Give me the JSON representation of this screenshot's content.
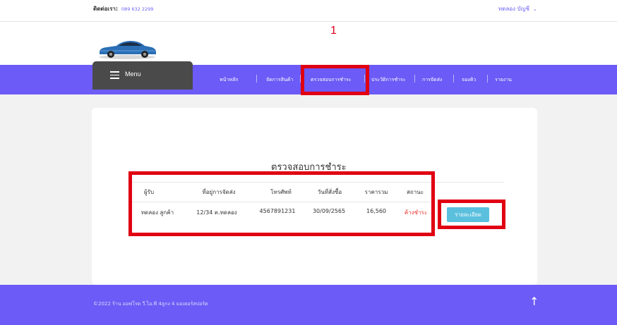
{
  "topbar": {
    "contact_label": "ติดต่อเรา:",
    "contact_phone": "089 632 2299",
    "user_name": "ทดลอง บัญชี",
    "user_chevron": "⌄"
  },
  "logo": {
    "icon": "car-icon"
  },
  "annotation_number": "1",
  "navbar": {
    "menu_label": "Menu",
    "items": [
      {
        "label": "หน้าหลัก"
      },
      {
        "label": "จัดการสินค้า"
      },
      {
        "label": "ตรวจสอบการชำระ"
      },
      {
        "label": "ประวัติการชำระ"
      },
      {
        "label": "การจัดส่ง"
      },
      {
        "label": "จองคิว"
      },
      {
        "label": "รายงาน"
      }
    ]
  },
  "main": {
    "title": "ตรวจสอบการชำระ",
    "table": {
      "headers": [
        "ผู้รับ",
        "ที่อยู่การจัดส่ง",
        "โทรศัพท์",
        "วันที่สั่งซื้อ",
        "ราคารวม",
        "สถานะ"
      ],
      "rows": [
        [
          "ทดลอง ลูกค้า",
          "12/34 ต.ทดลอง",
          "4567891231",
          "30/09/2565",
          "16,560",
          "ค้างชำระ"
        ]
      ]
    },
    "detail_button": "รายละเอียด"
  },
  "footer": {
    "copyright": "©2022 ร้าน ออฟโรด วี.ไอ.พี 4ลูกง 4 มอเตอร์สปอร์ต",
    "scroll_top": "↑"
  },
  "colors": {
    "brand_purple": "#6c5bf6",
    "menu_dark": "#4a4a4a",
    "highlight_red": "#e00012",
    "info_button": "#5bc0de",
    "status_red": "#e8322a"
  }
}
